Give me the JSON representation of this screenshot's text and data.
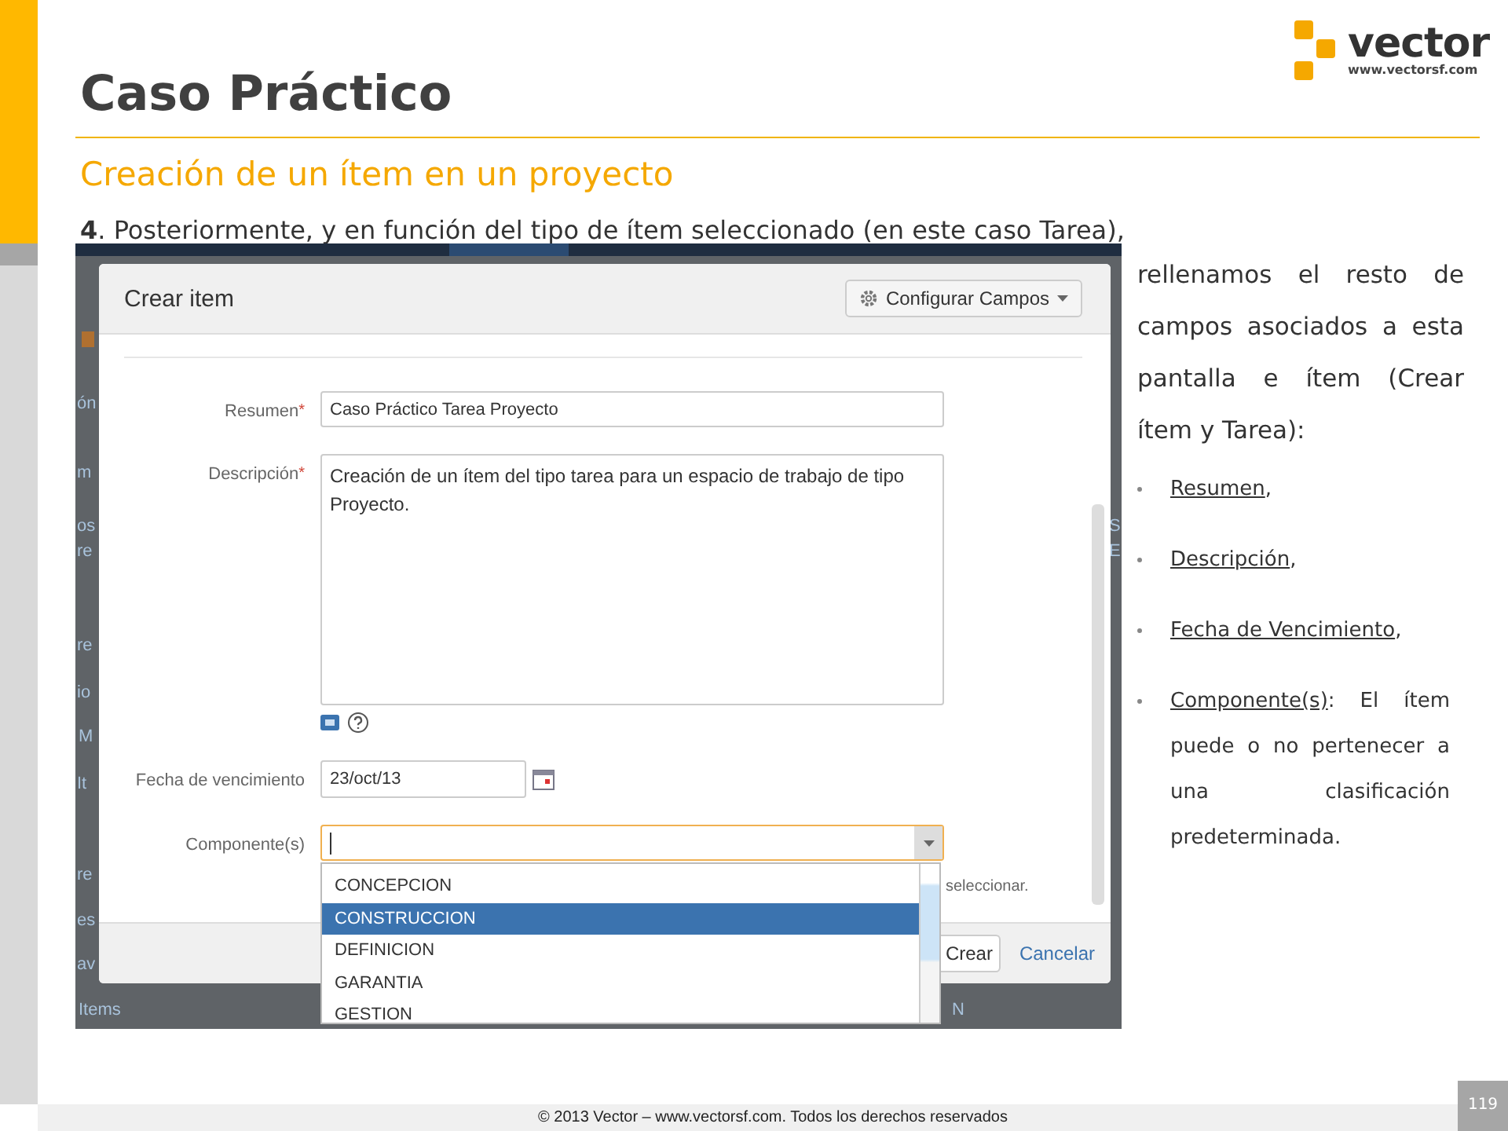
{
  "logo": {
    "name": "vector",
    "url": "www.vectorsf.com"
  },
  "title": "Caso Práctico",
  "subtitle": "Creación de un ítem en un proyecto",
  "intro": "**4**. Posteriormente, y en función del tipo de ítem seleccionado (en este caso Tarea),",
  "screenshot": {
    "background_fragments": [
      "ón",
      "m",
      "os",
      "re",
      "re",
      "io",
      "M",
      "It",
      "re",
      "es",
      "av",
      "Items",
      "S",
      "E",
      "N"
    ],
    "dialog": {
      "title": "Crear item",
      "config_button": "Configurar Campos",
      "required_mark": "*",
      "fields": [
        {
          "kind": "text",
          "label": "Resumen",
          "required": true,
          "value": "Caso Práctico Tarea Proyecto"
        },
        {
          "kind": "textarea",
          "label": "Descripción",
          "required": true,
          "value": "Creación de un ítem del tipo tarea para un espacio de trabajo de tipo Proyecto."
        },
        {
          "kind": "date",
          "label": "Fecha de vencimiento",
          "required": false,
          "value": "23/oct/13"
        },
        {
          "kind": "select",
          "label": "Componente(s)",
          "required": false,
          "focused": true
        }
      ],
      "hint": "seleccionar.",
      "dropdown": [
        {
          "label": "CONCEPCION",
          "selected": false
        },
        {
          "label": "CONSTRUCCION",
          "selected": true
        },
        {
          "label": "DEFINICION",
          "selected": false
        },
        {
          "label": "GARANTIA",
          "selected": false
        },
        {
          "label": "GESTION",
          "selected": false
        }
      ],
      "submit": "Crear",
      "cancel": "Cancelar"
    }
  },
  "side_text": "rellenamos el resto de campos asociados a esta pantalla e ítem (Crear ítem y Tarea):",
  "bullets": [
    {
      "term": "Resumen",
      "rest": ","
    },
    {
      "term": "Descripción",
      "rest": ","
    },
    {
      "term": "Fecha de Vencimiento",
      "rest": ","
    },
    {
      "term": "Componente(s)",
      "rest": ": El ítem puede o no pertenecer a una clasificación predeterminada."
    }
  ],
  "footer": "© 2013 Vector – www.vectorsf.com. Todos los derechos reservados",
  "page_number": "119"
}
